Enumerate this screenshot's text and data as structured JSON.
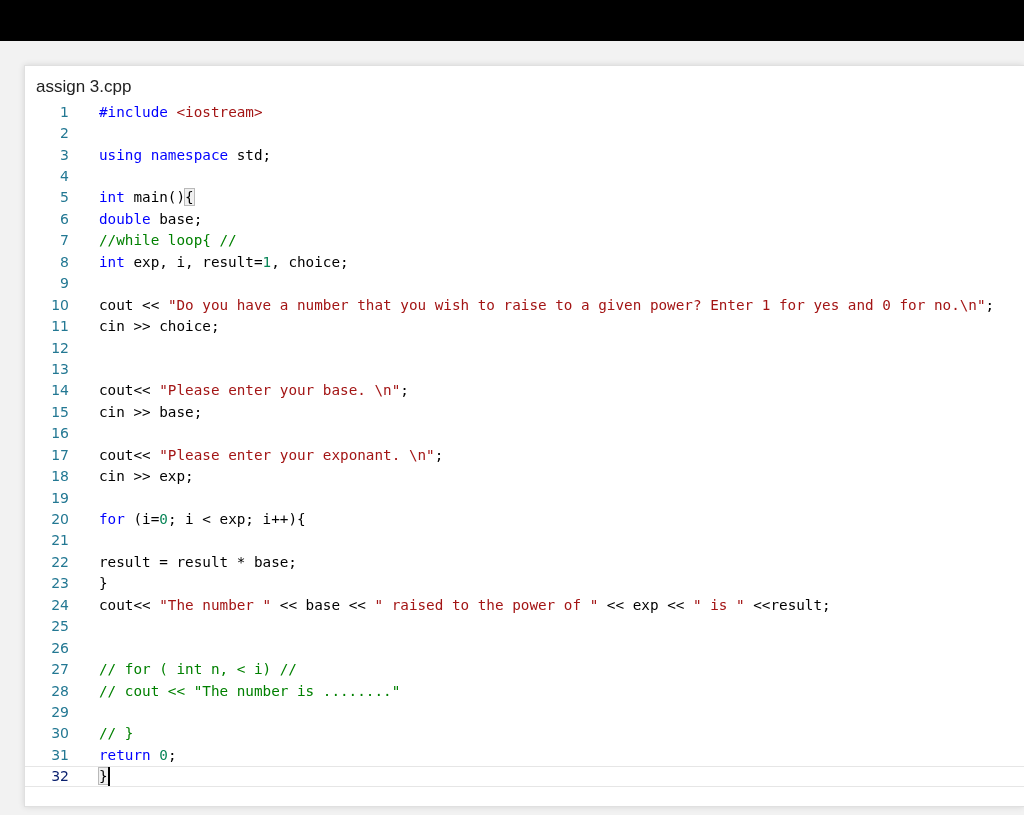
{
  "editor": {
    "title": "assign 3.cpp",
    "lines": [
      {
        "number": "1",
        "current": false,
        "tokens": [
          {
            "kind": "keyword",
            "text": "#include"
          },
          {
            "kind": "string",
            "text": " <iostream>"
          }
        ]
      },
      {
        "number": "2",
        "current": false
      },
      {
        "number": "3",
        "current": false,
        "tokens": [
          {
            "kind": "keyword",
            "text": "using namespace"
          },
          {
            "kind": "text",
            "text": " std;"
          }
        ]
      },
      {
        "number": "4",
        "current": false
      },
      {
        "number": "5",
        "current": false,
        "tokens": [
          {
            "kind": "keyword",
            "text": "int"
          },
          {
            "kind": "text",
            "text": " main()"
          },
          {
            "kind": "brace",
            "text": "{"
          }
        ]
      },
      {
        "number": "6",
        "current": false,
        "tokens": [
          {
            "kind": "keyword",
            "text": "double"
          },
          {
            "kind": "text",
            "text": " base;"
          }
        ]
      },
      {
        "number": "7",
        "current": false,
        "tokens": [
          {
            "kind": "comment",
            "text": "//while loop{ //"
          }
        ]
      },
      {
        "number": "8",
        "current": false,
        "tokens": [
          {
            "kind": "keyword",
            "text": "int"
          },
          {
            "kind": "text",
            "text": " exp, i, result="
          },
          {
            "kind": "number",
            "text": "1"
          },
          {
            "kind": "text",
            "text": ", choice;"
          }
        ]
      },
      {
        "number": "9",
        "current": false
      },
      {
        "number": "10",
        "current": false,
        "tokens": [
          {
            "kind": "text",
            "text": "cout << "
          },
          {
            "kind": "string",
            "text": "\"Do you have a number that you wish to raise to a given power? Enter 1 for yes and 0 for no.\\n\""
          },
          {
            "kind": "text",
            "text": ";"
          }
        ]
      },
      {
        "number": "11",
        "current": false,
        "tokens": [
          {
            "kind": "text",
            "text": "cin >> choice;"
          }
        ]
      },
      {
        "number": "12",
        "current": false
      },
      {
        "number": "13",
        "current": false
      },
      {
        "number": "14",
        "current": false,
        "tokens": [
          {
            "kind": "text",
            "text": "cout<< "
          },
          {
            "kind": "string",
            "text": "\"Please enter your base. \\n\""
          },
          {
            "kind": "text",
            "text": ";"
          }
        ]
      },
      {
        "number": "15",
        "current": false,
        "tokens": [
          {
            "kind": "text",
            "text": "cin >> base;"
          }
        ]
      },
      {
        "number": "16",
        "current": false
      },
      {
        "number": "17",
        "current": false,
        "tokens": [
          {
            "kind": "text",
            "text": "cout<< "
          },
          {
            "kind": "string",
            "text": "\"Please enter your exponant. \\n\""
          },
          {
            "kind": "text",
            "text": ";"
          }
        ]
      },
      {
        "number": "18",
        "current": false,
        "tokens": [
          {
            "kind": "text",
            "text": "cin >> exp;"
          }
        ]
      },
      {
        "number": "19",
        "current": false
      },
      {
        "number": "20",
        "current": false,
        "tokens": [
          {
            "kind": "keyword",
            "text": "for"
          },
          {
            "kind": "text",
            "text": " (i="
          },
          {
            "kind": "number",
            "text": "0"
          },
          {
            "kind": "text",
            "text": "; i < exp; i++){"
          }
        ]
      },
      {
        "number": "21",
        "current": false
      },
      {
        "number": "22",
        "current": false,
        "tokens": [
          {
            "kind": "text",
            "text": "result = result * base;"
          }
        ]
      },
      {
        "number": "23",
        "current": false,
        "tokens": [
          {
            "kind": "text",
            "text": "}"
          }
        ]
      },
      {
        "number": "24",
        "current": false,
        "tokens": [
          {
            "kind": "text",
            "text": "cout<< "
          },
          {
            "kind": "string",
            "text": "\"The number \""
          },
          {
            "kind": "text",
            "text": " << base << "
          },
          {
            "kind": "string",
            "text": "\" raised to the power of \""
          },
          {
            "kind": "text",
            "text": " << exp << "
          },
          {
            "kind": "string",
            "text": "\" is \""
          },
          {
            "kind": "text",
            "text": " <<result;"
          }
        ]
      },
      {
        "number": "25",
        "current": false
      },
      {
        "number": "26",
        "current": false
      },
      {
        "number": "27",
        "current": false,
        "tokens": [
          {
            "kind": "comment",
            "text": "// for ( int n, < i) //"
          }
        ]
      },
      {
        "number": "28",
        "current": false,
        "tokens": [
          {
            "kind": "comment",
            "text": "// cout << \"The number is ........\""
          }
        ]
      },
      {
        "number": "29",
        "current": false
      },
      {
        "number": "30",
        "current": false,
        "tokens": [
          {
            "kind": "comment",
            "text": "// }"
          }
        ]
      },
      {
        "number": "31",
        "current": false,
        "tokens": [
          {
            "kind": "keyword",
            "text": "return"
          },
          {
            "kind": "number",
            "text": " 0"
          },
          {
            "kind": "text",
            "text": ";"
          }
        ]
      },
      {
        "number": "32",
        "current": true,
        "tokens": [
          {
            "kind": "brace",
            "text": "}"
          }
        ]
      }
    ]
  }
}
